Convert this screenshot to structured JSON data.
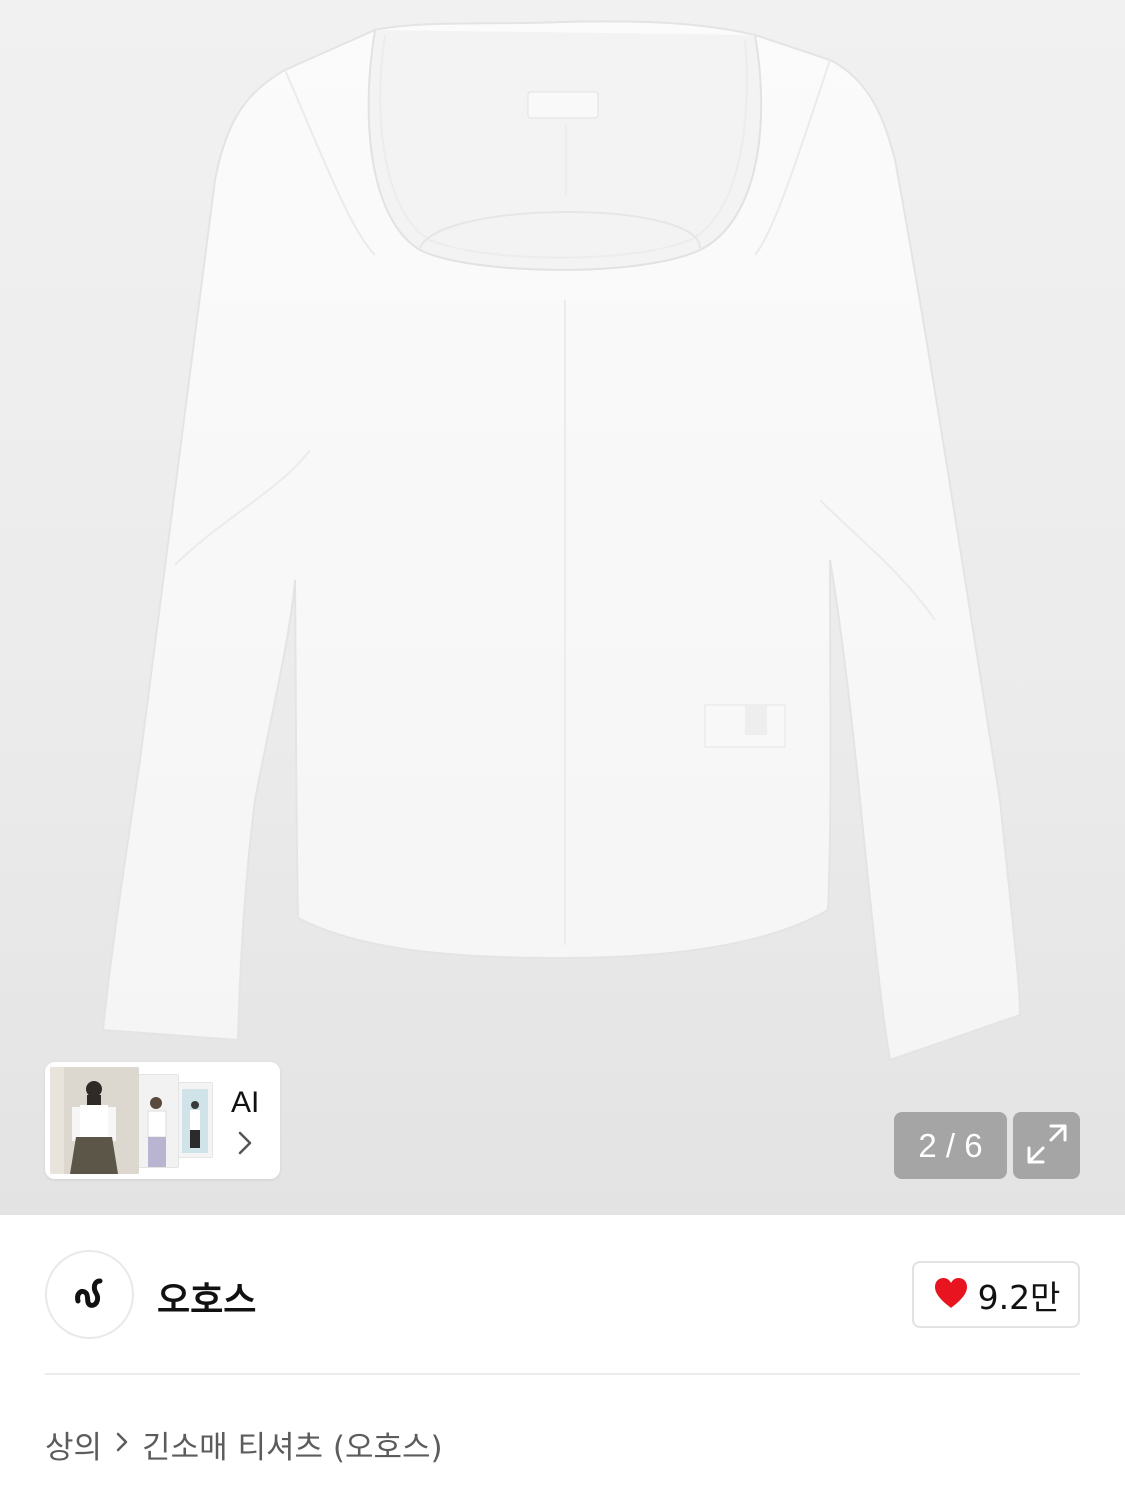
{
  "gallery": {
    "counter_text": "2 / 6",
    "current_index": 2,
    "total": 6,
    "ai_label": "AI",
    "expand_icon": "expand-arrows-icon",
    "chevron_icon": "chevron-right-icon"
  },
  "brand": {
    "name": "오호스",
    "logo_icon": "brand-logo-icon"
  },
  "likes": {
    "count_text": "9.2만",
    "icon": "heart-icon",
    "color": "#e8141f"
  },
  "breadcrumb": {
    "items": [
      "상의",
      "긴소매 티셔츠 (오호스)"
    ],
    "separator_icon": "chevron-right-icon"
  }
}
